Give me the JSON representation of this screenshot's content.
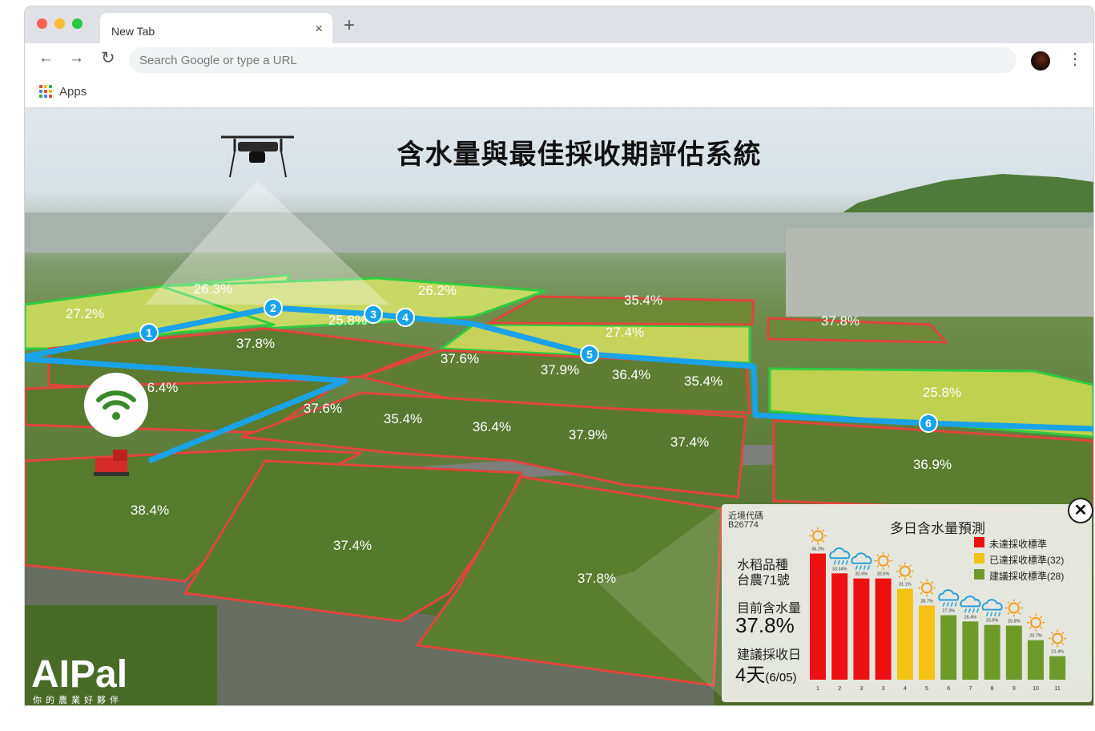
{
  "browser": {
    "tab_title": "New Tab",
    "tab_close": "×",
    "new_tab": "+",
    "back": "←",
    "forward": "→",
    "reload": "↻",
    "omnibox_placeholder": "Search Google or type a URL",
    "menu": "⋮",
    "bookmarks_apps": "Apps",
    "colors": {
      "close": "#ff5f57",
      "minimize": "#febc2e",
      "maximize": "#28c840"
    }
  },
  "page": {
    "title": "含水量與最佳採收期評估系統",
    "logo": "AIPal",
    "logo_sub": "你的農業好夥伴",
    "wifi_icon": "wifi-icon",
    "field_labels": [
      "27.2%",
      "26.3%",
      "25.8%",
      "26.2%",
      "35.4%",
      "37.8%",
      "37.8%",
      "27.4%",
      "6.4%",
      "37.6%",
      "37.9%",
      "36.4%",
      "35.4%",
      "25.8%",
      "37.6%",
      "35.4%",
      "36.4%",
      "37.9%",
      "37.4%",
      "36.9%",
      "38.4%",
      "37.4%",
      "37.8%"
    ],
    "route_points": [
      "1",
      "2",
      "3",
      "4",
      "5",
      "6"
    ],
    "colors": {
      "route": "#1aa3e8",
      "field_dry": "#2ecc40",
      "field_wet": "#e0453c"
    }
  },
  "panel": {
    "code_label": "近境代碼",
    "code_value": "B26774",
    "forecast_title": "多日含水量預測",
    "variety_label": "水稻品種",
    "variety_value": "台農71號",
    "moisture_label": "目前含水量",
    "moisture_value": "37.8%",
    "harvest_label": "建議採收日",
    "harvest_value": "4天",
    "harvest_date": "(6/05)",
    "close": "✕",
    "legend": [
      {
        "label": "未達採收標準",
        "color": "#ee1111"
      },
      {
        "label": "已達採收標準(32)",
        "color": "#f5c211"
      },
      {
        "label": "建議採收標準(28)",
        "color": "#6f9a2a"
      }
    ]
  },
  "chart_data": {
    "type": "bar",
    "title": "多日含水量預測",
    "categories": [
      "1",
      "2",
      "3",
      "3",
      "4",
      "5",
      "6",
      "7",
      "8",
      "9",
      "10",
      "11"
    ],
    "values": [
      36.2,
      33.34,
      32.6,
      32.6,
      31.1,
      28.7,
      27.3,
      26.4,
      25.9,
      25.8,
      23.7,
      21.4
    ],
    "value_labels": [
      "36.2%",
      "33.34%",
      "32.6%",
      "32.6%",
      "31.1%",
      "28.7%",
      "27.3%",
      "26.4%",
      "25.9%",
      "25.8%",
      "23.7%",
      "21.4%"
    ],
    "bar_colors": [
      "#ee1111",
      "#ee1111",
      "#ee1111",
      "#ee1111",
      "#f5c211",
      "#f5c211",
      "#6f9a2a",
      "#6f9a2a",
      "#6f9a2a",
      "#6f9a2a",
      "#6f9a2a",
      "#6f9a2a"
    ],
    "weather": [
      "sun-icon",
      "rain-icon",
      "rain-icon",
      "sun-icon",
      "sun-icon",
      "sun-icon",
      "rain-icon",
      "rain-icon",
      "rain-icon",
      "sun-icon",
      "sun-icon",
      "sun-icon"
    ],
    "ylim": [
      18,
      38
    ],
    "xlabel": "",
    "ylabel": ""
  }
}
